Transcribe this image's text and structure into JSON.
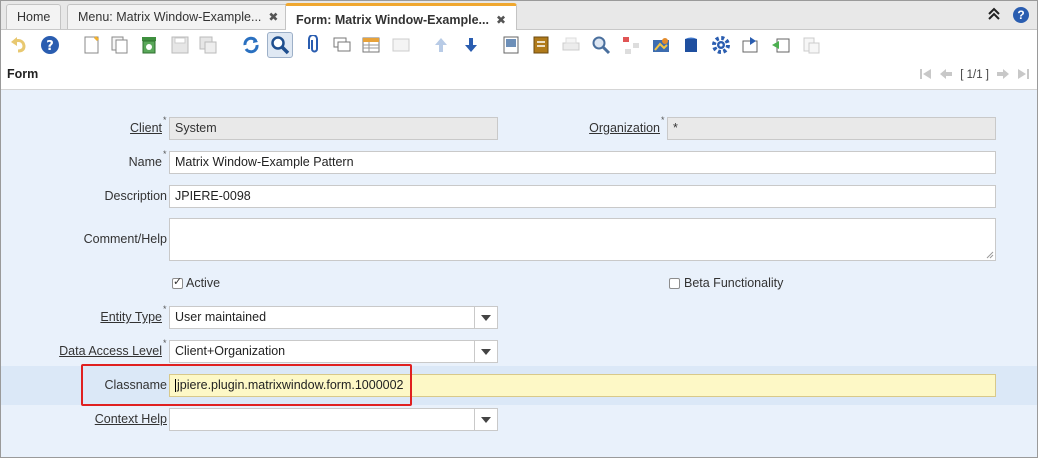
{
  "tabs": {
    "home": "Home",
    "menu": "Menu: Matrix Window-Example...",
    "form": "Form: Matrix Window-Example...",
    "close_glyph": "✖"
  },
  "header_actions": {
    "collapse_glyph": "≫",
    "help_glyph": "?"
  },
  "titlebar": {
    "title": "Form",
    "record": "[ 1/1 ]"
  },
  "form": {
    "client": {
      "label": "Client",
      "value": "System"
    },
    "organization": {
      "label": "Organization",
      "value": "*"
    },
    "name": {
      "label": "Name",
      "value": "Matrix Window-Example Pattern"
    },
    "description": {
      "label": "Description",
      "value": "JPIERE-0098"
    },
    "comment": {
      "label": "Comment/Help",
      "value": ""
    },
    "active": {
      "label": "Active",
      "checked": true
    },
    "beta": {
      "label": "Beta Functionality",
      "checked": false
    },
    "entity_type": {
      "label": "Entity Type",
      "value": "User maintained"
    },
    "data_access": {
      "label": "Data Access Level",
      "value": "Client+Organization"
    },
    "classname": {
      "label": "Classname",
      "value": "jpiere.plugin.matrixwindow.form.1000002"
    },
    "context_help": {
      "label": "Context Help",
      "value": ""
    },
    "required_mark": "*"
  },
  "colors": {
    "accent_tab": "#f0a830",
    "highlight_box": "#e02020",
    "form_bg": "#e9f1fb",
    "focus_field": "#fdf8c6"
  }
}
